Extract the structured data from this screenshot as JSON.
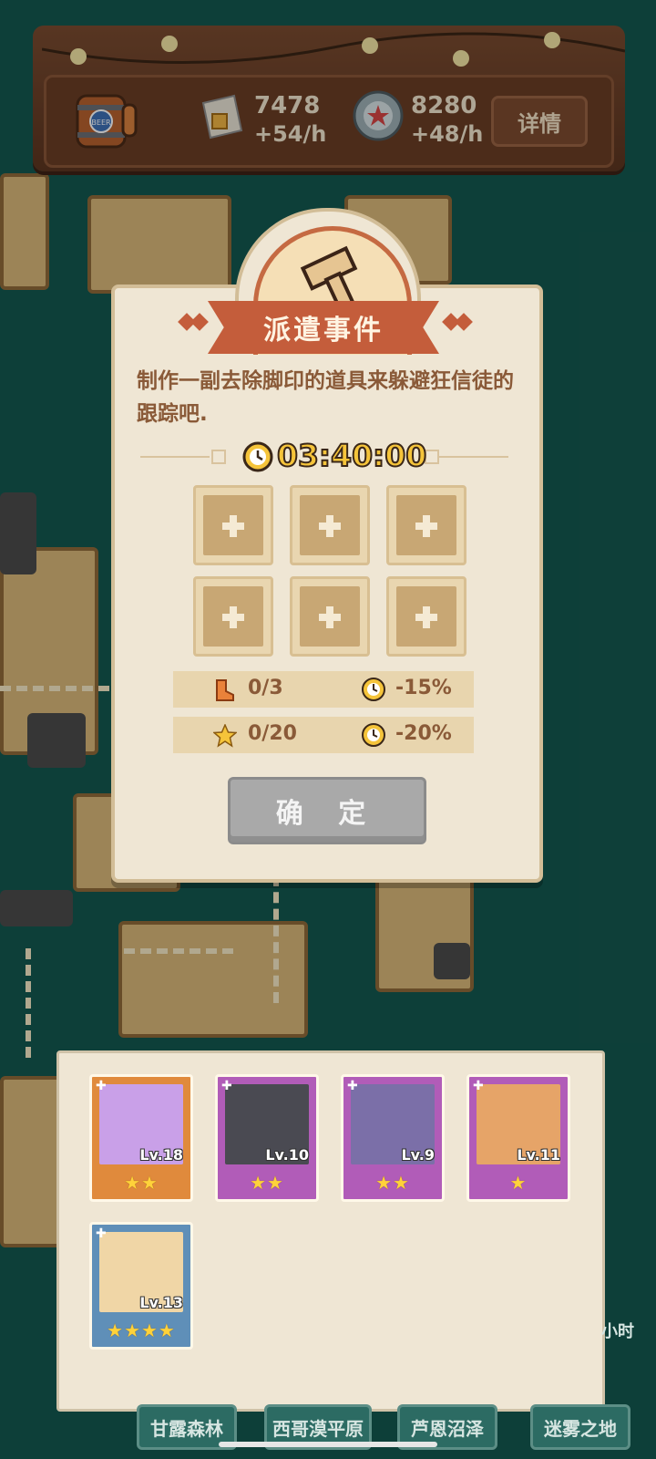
{
  "resources": {
    "beer_label": "BEER",
    "food_amount": "7478",
    "food_rate": "+54/h",
    "cap_amount": "8280",
    "cap_rate": "+48/h",
    "details_label": "详情"
  },
  "dialog": {
    "title": "派遣事件",
    "description": "制作一副去除脚印的道具来躲避狂信徒的跟踪吧.",
    "timer": "03:40:00",
    "slot_count": 6,
    "bonuses": [
      {
        "icon": "boot-icon",
        "progress": "0/3",
        "reduction": "-15%"
      },
      {
        "icon": "star-icon",
        "progress": "0/20",
        "reduction": "-20%"
      }
    ],
    "confirm_label": "确 定"
  },
  "heroes": [
    {
      "level": "Lv.18",
      "stars": "★★",
      "rarity_color": "#e08a3c"
    },
    {
      "level": "Lv.10",
      "stars": "★★",
      "rarity_color": "#b15cb8"
    },
    {
      "level": "Lv.9",
      "stars": "★★",
      "rarity_color": "#b15cb8"
    },
    {
      "level": "Lv.11",
      "stars": "★",
      "rarity_color": "#b15cb8"
    },
    {
      "level": "Lv.13",
      "stars": "★★★★",
      "rarity_color": "#5f8fb8"
    }
  ],
  "regions": [
    "甘露森林",
    "西哥漠平原",
    "芦恩沼泽",
    "迷雾之地"
  ],
  "side_label": "小时"
}
